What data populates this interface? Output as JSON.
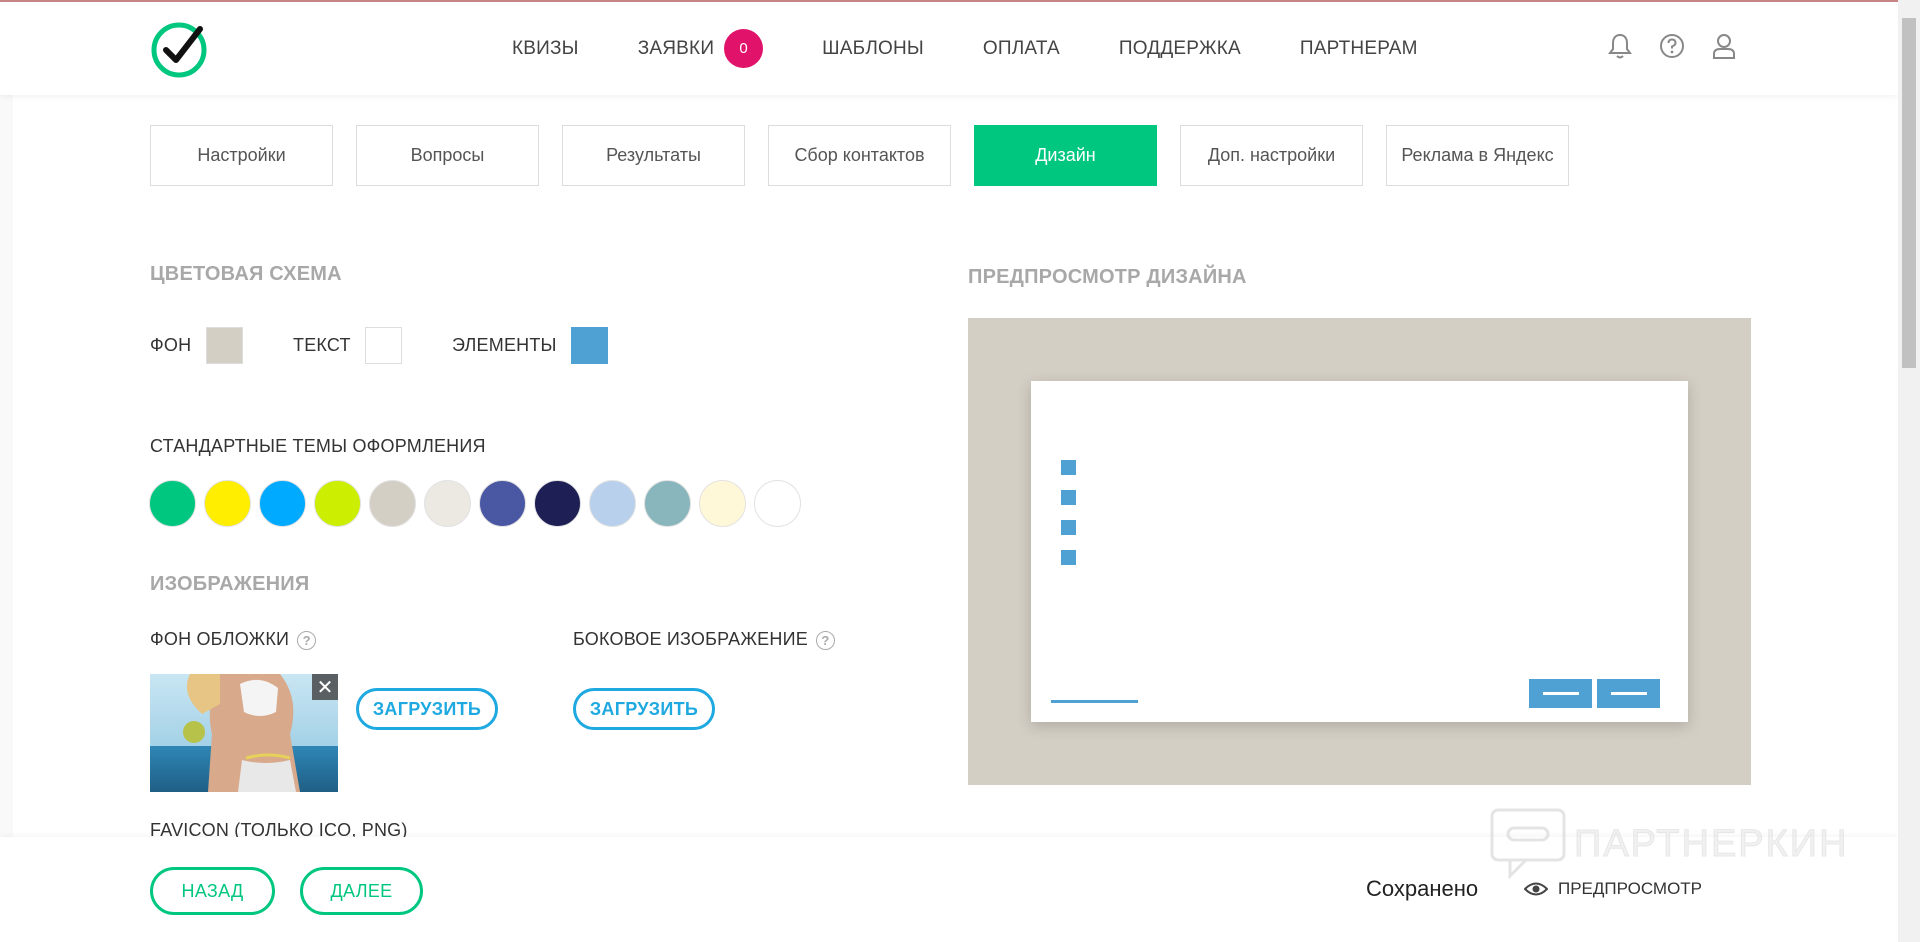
{
  "header": {
    "nav": [
      {
        "label": "КВИЗЫ"
      },
      {
        "label": "ЗАЯВКИ",
        "badge": "0"
      },
      {
        "label": "ШАБЛОНЫ"
      },
      {
        "label": "ОПЛАТА"
      },
      {
        "label": "ПОДДЕРЖКА"
      },
      {
        "label": "ПАРТНЕРАМ"
      }
    ],
    "icons": [
      "bell-icon",
      "help-icon",
      "user-icon"
    ]
  },
  "tabs": [
    {
      "label": "Настройки",
      "active": false
    },
    {
      "label": "Вопросы",
      "active": false
    },
    {
      "label": "Результаты",
      "active": false
    },
    {
      "label": "Сбор контактов",
      "active": false
    },
    {
      "label": "Дизайн",
      "active": true
    },
    {
      "label": "Доп. настройки",
      "active": false
    },
    {
      "label": "Реклама в Яндекс",
      "active": false
    }
  ],
  "color_scheme": {
    "title": "ЦВЕТОВАЯ СХЕМА",
    "bg_label": "ФОН",
    "bg_color": "#d4cfc5",
    "text_label": "ТЕКСТ",
    "text_color": "#ffffff",
    "elements_label": "ЭЛЕМЕНТЫ",
    "elements_color": "#4fa1d4"
  },
  "themes": {
    "title": "СТАНДАРТНЫЕ ТЕМЫ ОФОРМЛЕНИЯ",
    "colors": [
      "#00c77f",
      "#ffee00",
      "#00aaff",
      "#ccee00",
      "#d4cfc5",
      "#ece9e3",
      "#4a57a3",
      "#1d1f55",
      "#b8d0ec",
      "#88b6bc",
      "#fff8d8",
      "#ffffff"
    ]
  },
  "images": {
    "title": "ИЗОБРАЖЕНИЯ",
    "cover_label": "ФОН ОБЛОЖКИ",
    "side_label": "БОКОВОЕ ИЗОБРАЖЕНИЕ",
    "upload_label": "ЗАГРУЗИТЬ",
    "favicon_label": "FAVICON (ТОЛЬКО ICO, PNG)"
  },
  "preview": {
    "title": "ПРЕДПРОСМОТР ДИЗАЙНА"
  },
  "footer": {
    "back": "НАЗАД",
    "next": "ДАЛЕЕ",
    "saved": "Сохранено",
    "preview": "ПРЕДПРОСМОТР"
  },
  "watermark": "ПАРТНЕРКИН"
}
